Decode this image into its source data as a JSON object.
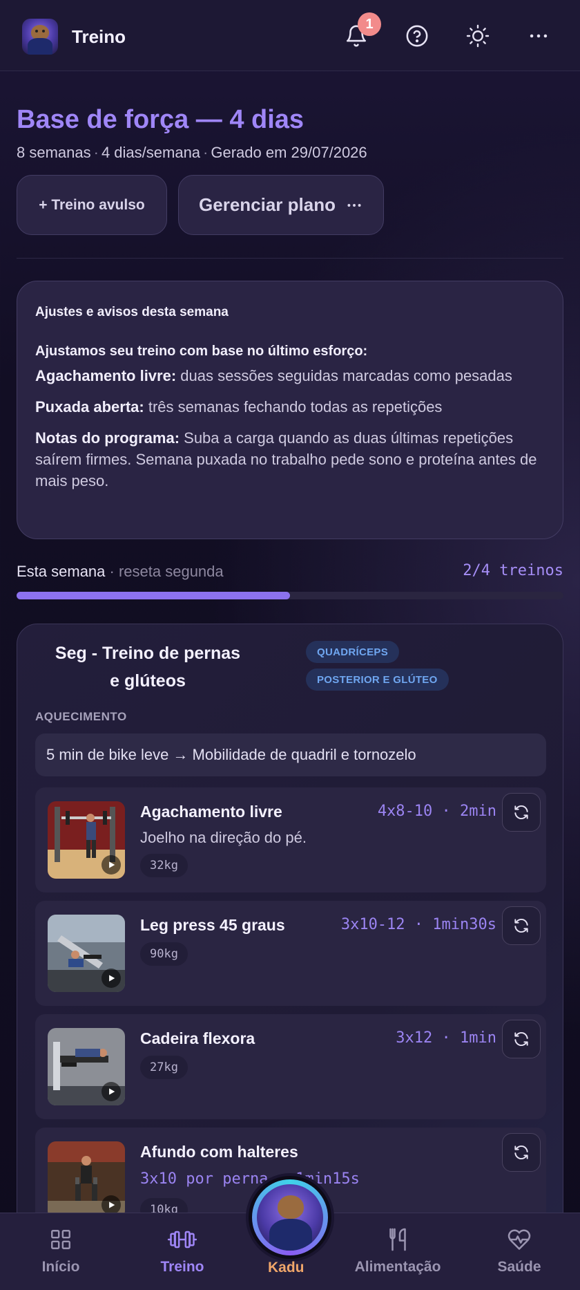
{
  "header": {
    "app_title": "Treino",
    "notification_count": "1",
    "icons": [
      "bell-icon",
      "help-circle-icon",
      "sun-icon",
      "more-horizontal-icon"
    ]
  },
  "plan": {
    "title": "Base de força — 4 dias",
    "meta": [
      "8 semanas",
      "4 dias/semana",
      "Gerado em 29/07/2026"
    ],
    "btn_avulso": "+ Treino avulso",
    "btn_gerenciar": "Gerenciar plano"
  },
  "adjustments": {
    "title": "Ajustes e avisos desta semana",
    "lead": "Ajustamos seu treino com base no último esforço:",
    "items": [
      {
        "label": "Agachamento livre:",
        "text": " duas sessões seguidas marcadas como pesadas"
      },
      {
        "label": "Puxada aberta:",
        "text": " três semanas fechando todas as repetições"
      }
    ],
    "notes_label": "Notas do programa:",
    "notes_text": " Suba a carga quando as duas últimas repetições saírem firmes. Semana puxada no trabalho pede sono e proteína antes de mais peso."
  },
  "progress": {
    "label": "Esta semana",
    "reset": "reseta segunda",
    "count": "2/4 treinos",
    "fraction": 0.5
  },
  "workout": {
    "title": "Seg - Treino de pernas e glúteos",
    "tags": [
      "QUADRÍCEPS",
      "POSTERIOR E GLÚTEO"
    ],
    "warmup_label": "AQUECIMENTO",
    "warmup": "5 min de bike leve → Mobilidade de quadril e tornozelo",
    "exercises": [
      {
        "name": "Agachamento livre",
        "spec": "4x8-10 · 2min",
        "note": "Joelho na direção do pé.",
        "weight": "32kg"
      },
      {
        "name": "Leg press 45 graus",
        "spec": "3x10-12 · 1min30s",
        "note": "",
        "weight": "90kg"
      },
      {
        "name": "Cadeira flexora",
        "spec": "3x12 · 1min",
        "note": "",
        "weight": "27kg"
      },
      {
        "name": "Afundo com halteres",
        "spec": "3x10 por perna · 1min15s",
        "note": "",
        "weight": "10kg"
      }
    ]
  },
  "nav": {
    "items": [
      {
        "label": "Início",
        "icon": "grid-icon"
      },
      {
        "label": "Treino",
        "icon": "dumbbell-icon"
      },
      {
        "label": "Kadu",
        "icon": "kadu-avatar"
      },
      {
        "label": "Alimentação",
        "icon": "utensils-icon"
      },
      {
        "label": "Saúde",
        "icon": "heart-pulse-icon"
      }
    ]
  },
  "colors": {
    "accent": "#9f86f7",
    "progress_fill": "#8c72ee",
    "tag_text": "#6fa6f0",
    "badge": "#f28b8b",
    "kadu_label": "#f0a66a"
  }
}
